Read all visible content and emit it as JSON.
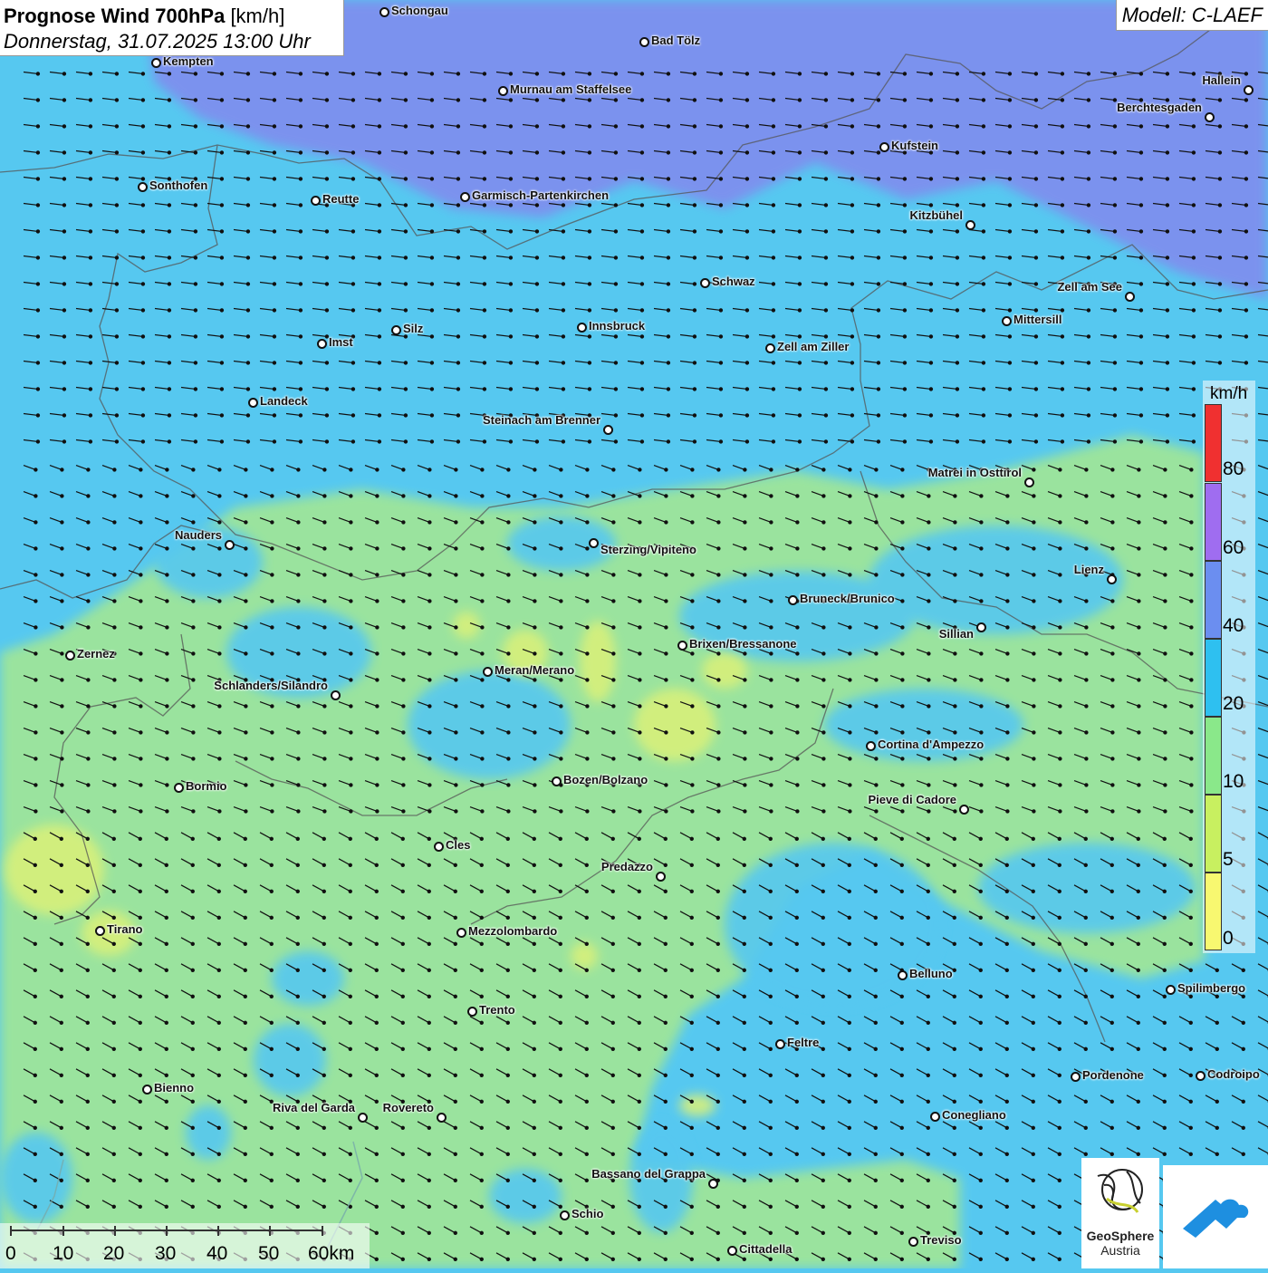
{
  "header": {
    "title_bold": "Prognose Wind 700hPa",
    "title_unit": "[km/h]",
    "datetime": "Donnerstag, 31.07.2025 13:00 Uhr",
    "model": "Modell: C-LAEF"
  },
  "legend": {
    "unit": "km/h",
    "ticks": [
      "80",
      "60",
      "40",
      "20",
      "10",
      "5",
      "0"
    ],
    "colors": [
      "#f03030",
      "#9f6df0",
      "#6b8ef0",
      "#2ec0f0",
      "#8ae88a",
      "#c8f060",
      "#f8f870"
    ]
  },
  "scale_bar": {
    "labels": [
      "0",
      "10",
      "20",
      "30",
      "40",
      "50",
      "60km"
    ]
  },
  "logos": {
    "geosphere_line1": "GeoSphere",
    "geosphere_line2": "Austria"
  },
  "wind": {
    "direction": "from north-west",
    "colors": {
      "strong": "#7e90ee",
      "moderate": "#56c8f0",
      "light": "#9ee59a",
      "calm": "#d8f07a"
    }
  },
  "cities": [
    {
      "name": "Schongau"
    },
    {
      "name": "Bad Tölz"
    },
    {
      "name": "Kempten"
    },
    {
      "name": "Murnau am Staffelsee"
    },
    {
      "name": "Hallein"
    },
    {
      "name": "Berchtesgaden"
    },
    {
      "name": "Kufstein"
    },
    {
      "name": "Sonthofen"
    },
    {
      "name": "Reutte"
    },
    {
      "name": "Garmisch-Partenkirchen"
    },
    {
      "name": "Kitzbühel"
    },
    {
      "name": "Schwaz"
    },
    {
      "name": "Zell am See"
    },
    {
      "name": "Mittersill"
    },
    {
      "name": "Innsbruck"
    },
    {
      "name": "Silz"
    },
    {
      "name": "Imst"
    },
    {
      "name": "Zell am Ziller"
    },
    {
      "name": "Landeck"
    },
    {
      "name": "Steinach am Brenner"
    },
    {
      "name": "Matrei in Osttirol"
    },
    {
      "name": "Nauders"
    },
    {
      "name": "Sterzing/Vipiteno"
    },
    {
      "name": "Lienz"
    },
    {
      "name": "Bruneck/Brunico"
    },
    {
      "name": "Sillian"
    },
    {
      "name": "Zernez"
    },
    {
      "name": "Brixen/Bressanone"
    },
    {
      "name": "Meran/Merano"
    },
    {
      "name": "Schlanders/Silandro"
    },
    {
      "name": "Cortina d'Ampezzo"
    },
    {
      "name": "Bozen/Bolzano"
    },
    {
      "name": "Bormio"
    },
    {
      "name": "Pieve di Cadore"
    },
    {
      "name": "Cles"
    },
    {
      "name": "Predazzo"
    },
    {
      "name": "Tirano"
    },
    {
      "name": "Mezzolombardo"
    },
    {
      "name": "Belluno"
    },
    {
      "name": "Spilimbergo"
    },
    {
      "name": "Trento"
    },
    {
      "name": "Feltre"
    },
    {
      "name": "Pordenone"
    },
    {
      "name": "Codroipo"
    },
    {
      "name": "Bienno"
    },
    {
      "name": "Riva del Garda"
    },
    {
      "name": "Rovereto"
    },
    {
      "name": "Conegliano"
    },
    {
      "name": "Bassano del Grappa"
    },
    {
      "name": "Schio"
    },
    {
      "name": "Treviso"
    },
    {
      "name": "Cittadella"
    }
  ]
}
